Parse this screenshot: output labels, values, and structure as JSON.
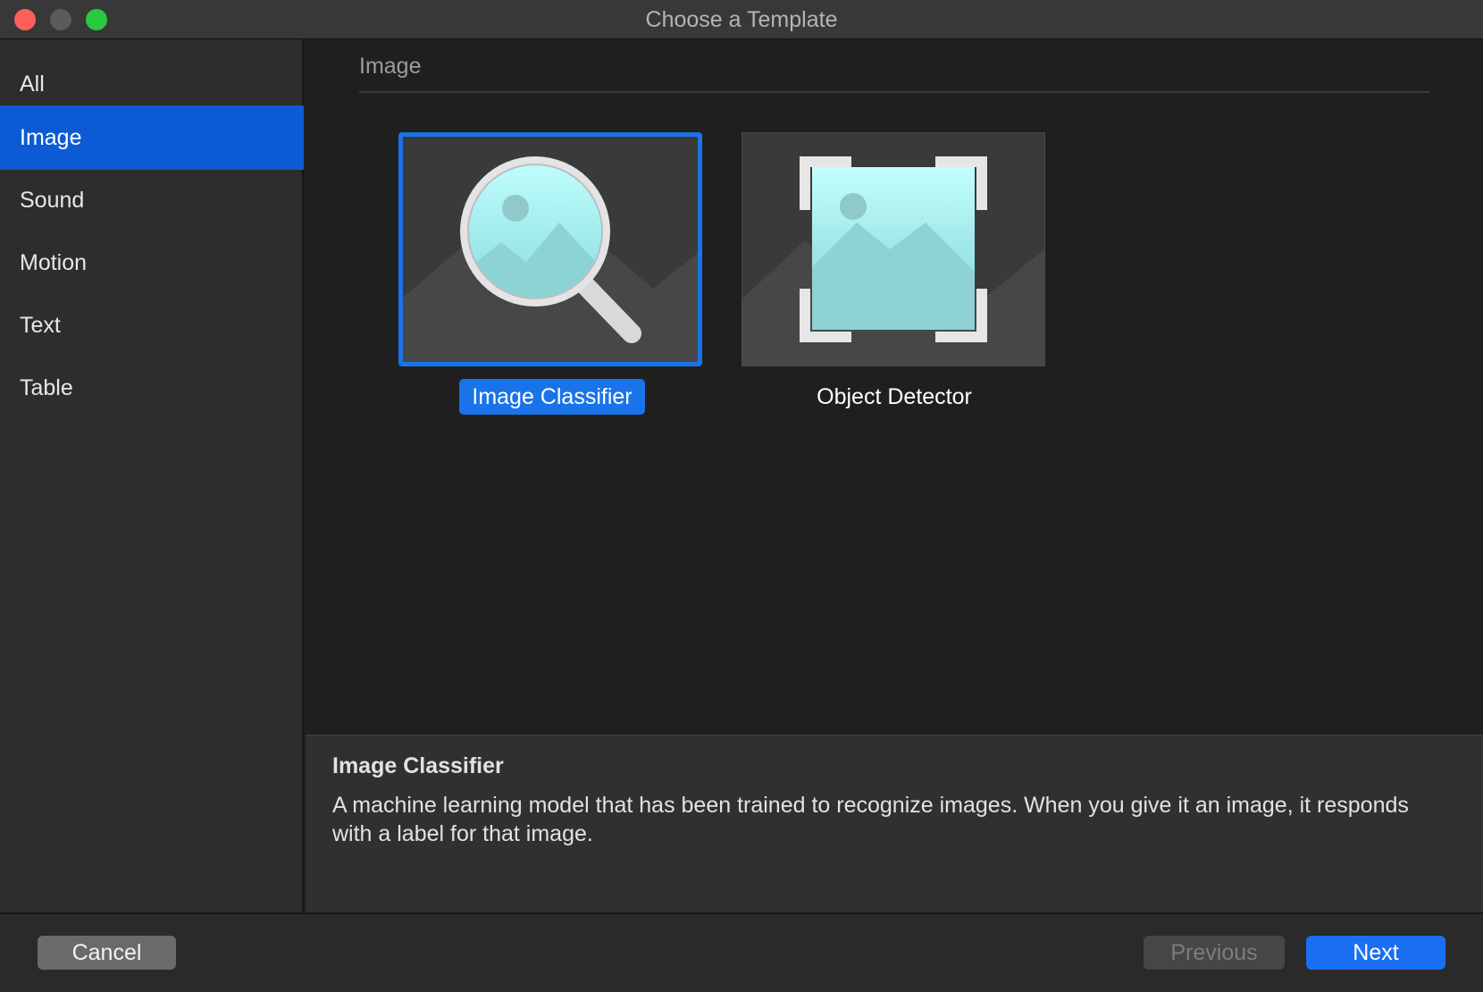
{
  "window": {
    "title": "Choose a Template"
  },
  "sidebar": {
    "items": [
      {
        "label": "All"
      },
      {
        "label": "Image"
      },
      {
        "label": "Sound"
      },
      {
        "label": "Motion"
      },
      {
        "label": "Text"
      },
      {
        "label": "Table"
      }
    ],
    "selected": "Image"
  },
  "main": {
    "section_label": "Image",
    "templates": [
      {
        "label": "Image Classifier",
        "icon": "image-magnifier-icon",
        "selected": true
      },
      {
        "label": "Object Detector",
        "icon": "image-detection-frame-icon",
        "selected": false
      }
    ]
  },
  "description": {
    "title": "Image Classifier",
    "body": "A machine learning model that has been trained to recognize images. When you give it an image, it responds with a label for that image."
  },
  "footer": {
    "cancel_label": "Cancel",
    "previous_label": "Previous",
    "next_label": "Next"
  },
  "colors": {
    "accent": "#1a73e8",
    "sidebar_selected": "#0d5bd4",
    "close": "#fe5f57",
    "maximize": "#29c940"
  }
}
